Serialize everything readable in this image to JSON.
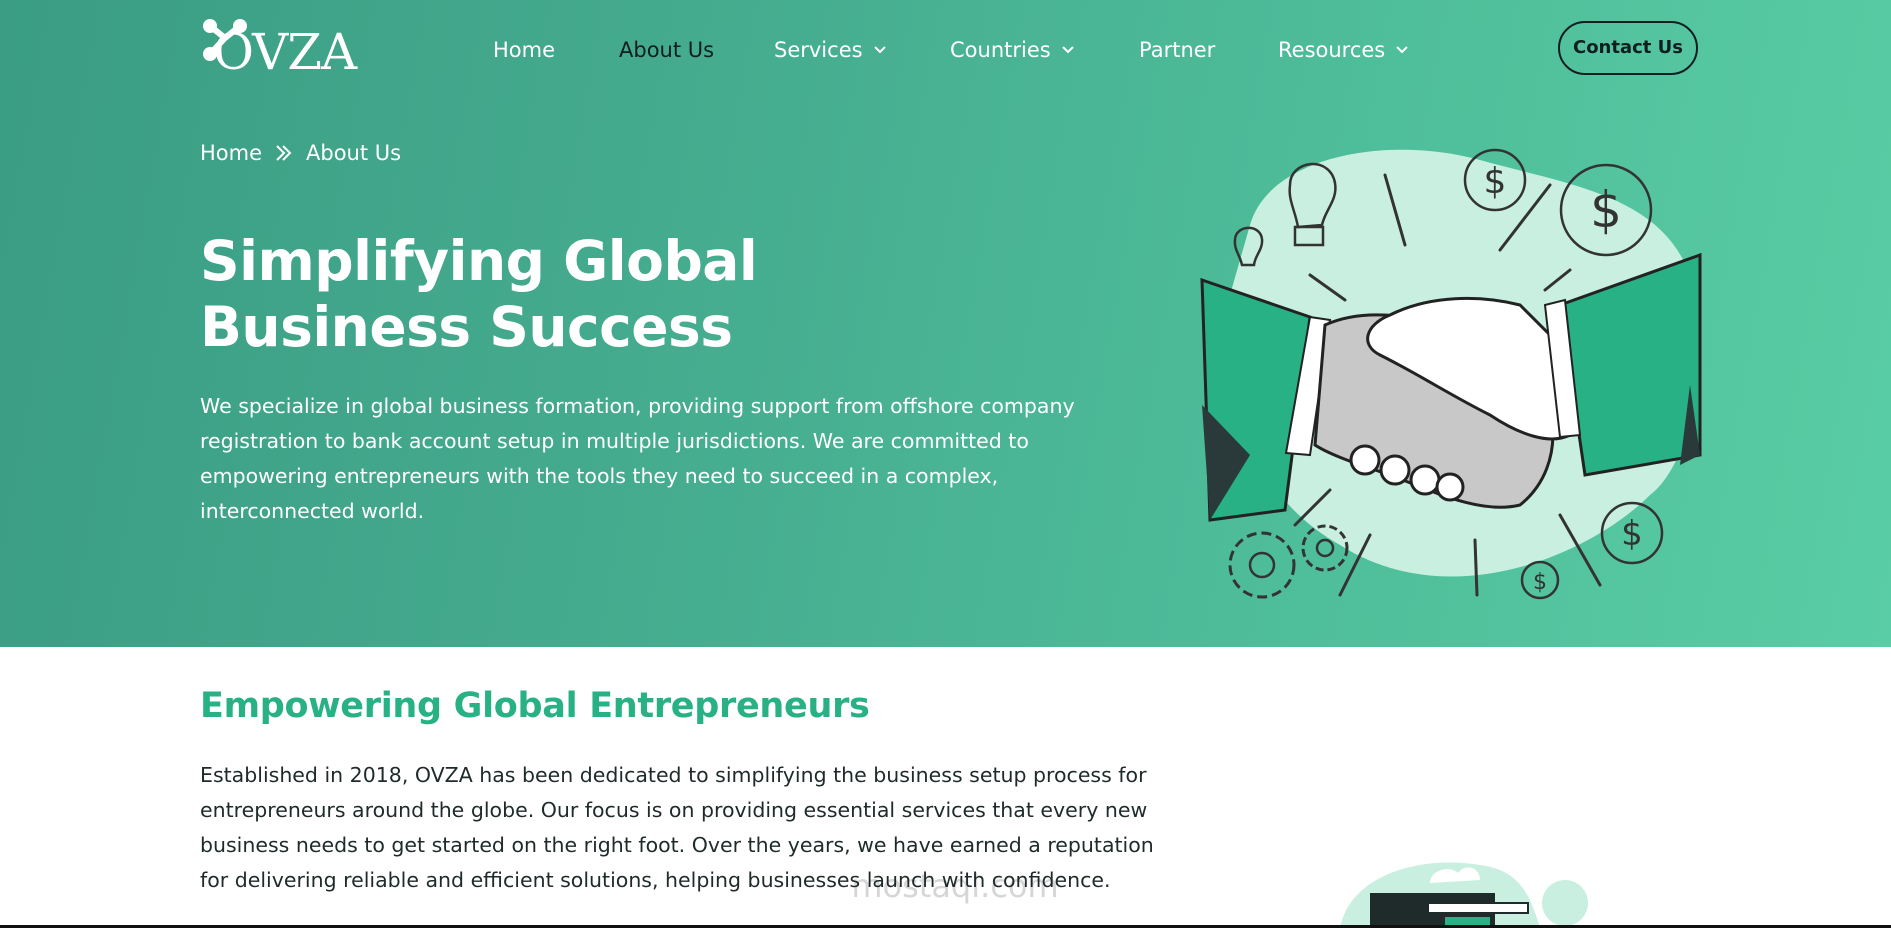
{
  "brand": {
    "logo_text": "OVZA"
  },
  "nav": {
    "items": [
      {
        "label": "Home",
        "dropdown": false
      },
      {
        "label": "About Us",
        "dropdown": false,
        "active": true
      },
      {
        "label": "Services",
        "dropdown": true
      },
      {
        "label": "Countries",
        "dropdown": true
      },
      {
        "label": "Partner",
        "dropdown": false
      },
      {
        "label": "Resources",
        "dropdown": true
      }
    ],
    "contact_label": "Contact Us"
  },
  "breadcrumb": {
    "home": "Home",
    "current": "About Us",
    "separator_icon": "double-chevron-right-icon"
  },
  "hero": {
    "title_line1": "Simplifying Global",
    "title_line2": "Business Success",
    "description": "We specialize in global business formation, providing support from offshore company registration to bank account setup in multiple jurisdictions. We are committed to empowering entrepreneurs with the tools they need to succeed in a complex, interconnected world.",
    "illustration": "handshake-illustration"
  },
  "section": {
    "title": "Empowering Global Entrepreneurs",
    "body": "Established in 2018, OVZA has been dedicated to simplifying the business setup process for entrepreneurs around the globe. Our focus is on providing essential services that every new business needs to get started on the right foot. Over the years, we have earned a reputation for delivering reliable and efficient solutions, helping businesses launch with confidence."
  },
  "watermark": {
    "text": "mostaql.com"
  },
  "colors": {
    "accent": "#27b184",
    "hero_start": "#3a9d84",
    "hero_end": "#59cda5",
    "dark": "#0f1f1f"
  }
}
